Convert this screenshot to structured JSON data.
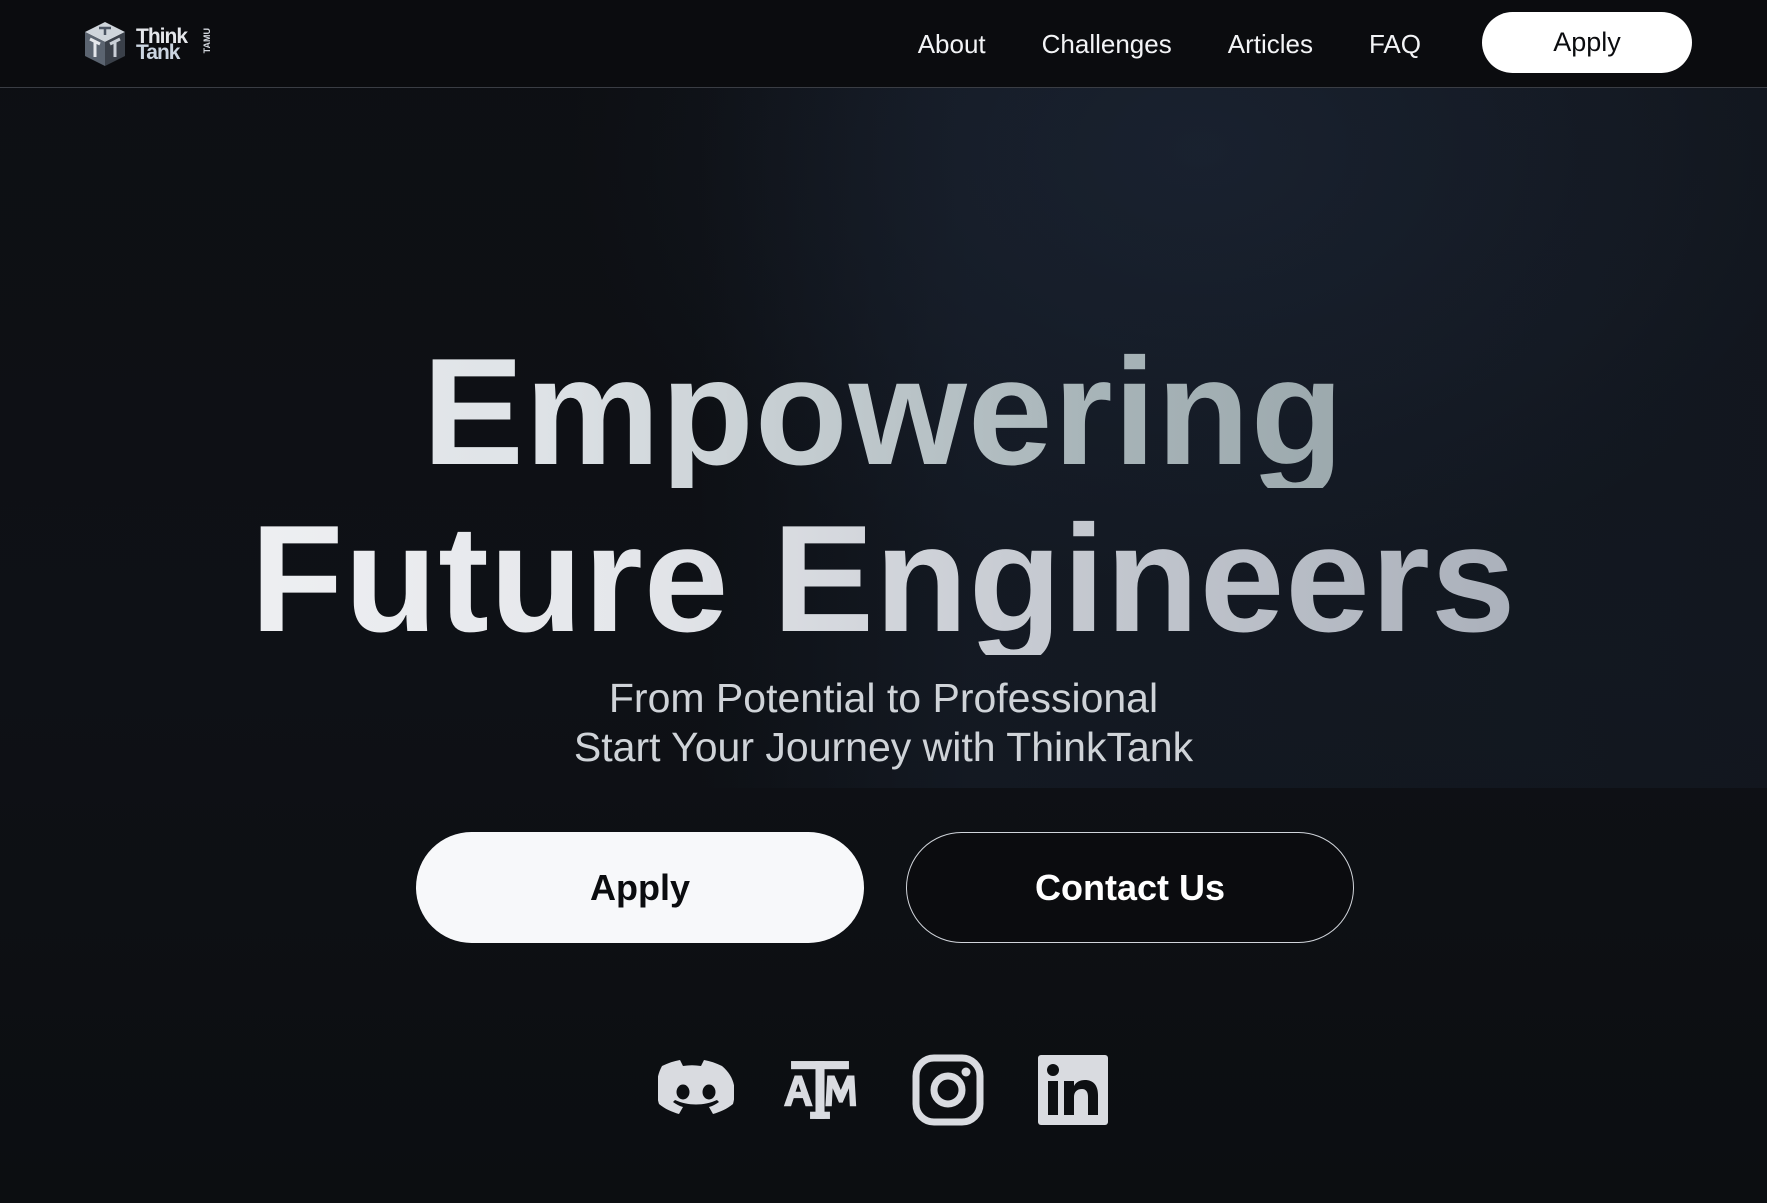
{
  "header": {
    "logo": {
      "word1": "Think",
      "word2": "Tank",
      "tag": "TAMU",
      "icon": "cube-logo-icon"
    },
    "nav": [
      {
        "label": "About"
      },
      {
        "label": "Challenges"
      },
      {
        "label": "Articles"
      },
      {
        "label": "FAQ"
      }
    ],
    "apply_label": "Apply"
  },
  "hero": {
    "title_line1": "Empowering",
    "title_line2": "Future Engineers",
    "subtitle_line1": "From Potential to Professional",
    "subtitle_line2": "Start Your Journey with ThinkTank",
    "primary_button": "Apply",
    "secondary_button": "Contact Us"
  },
  "socials": [
    {
      "name": "discord-icon"
    },
    {
      "name": "texas-am-icon"
    },
    {
      "name": "instagram-icon"
    },
    {
      "name": "linkedin-icon"
    }
  ],
  "colors": {
    "background": "#0d0f12",
    "nav_background": "#0b0c0f",
    "button_light": "#f7f8fa",
    "icon_color": "#d9dbe0"
  }
}
